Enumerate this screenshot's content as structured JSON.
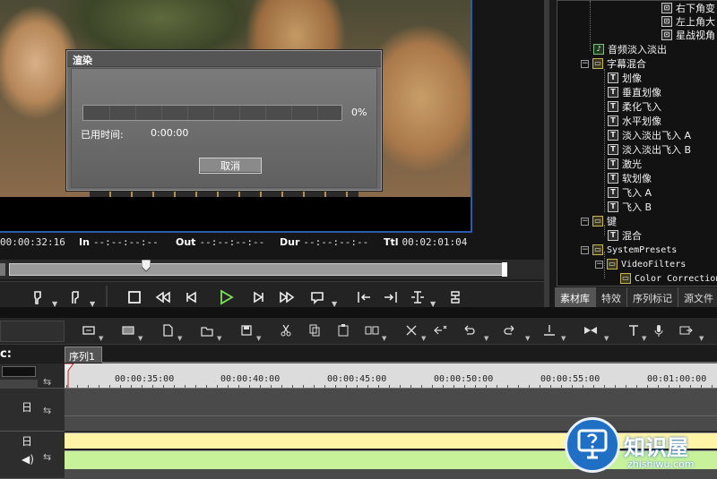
{
  "player": {
    "timecodes": [
      {
        "label": "",
        "value": "00:00:32:16"
      },
      {
        "label": "In",
        "value": "--:--:--:--"
      },
      {
        "label": "Out",
        "value": "--:--:--:--"
      },
      {
        "label": "Dur",
        "value": "--:--:--:--"
      },
      {
        "label": "Ttl",
        "value": "00:02:01:04"
      }
    ]
  },
  "render_dialog": {
    "title": "渲染",
    "progress_percent": 0,
    "progress_text": "0%",
    "elapsed_label": "已用时间:",
    "elapsed_value": "0:00:00",
    "cancel_label": "取消"
  },
  "asset_tree": {
    "items": [
      {
        "text": "右下角变",
        "icon": "effect-icon"
      },
      {
        "text": "左上角大",
        "icon": "effect-icon"
      },
      {
        "text": "星战视角",
        "icon": "effect-icon"
      },
      {
        "text": "音频淡入淡出",
        "icon": "audio-effect-icon"
      },
      {
        "text": "字幕混合",
        "icon": "folder-icon"
      },
      {
        "text": "划像",
        "icon": "title-effect-icon"
      },
      {
        "text": "垂直划像",
        "icon": "title-effect-icon"
      },
      {
        "text": "柔化飞入",
        "icon": "title-effect-icon"
      },
      {
        "text": "水平划像",
        "icon": "title-effect-icon"
      },
      {
        "text": "淡入淡出飞入 A",
        "icon": "title-effect-icon"
      },
      {
        "text": "淡入淡出飞入 B",
        "icon": "title-effect-icon"
      },
      {
        "text": "激光",
        "icon": "title-effect-icon"
      },
      {
        "text": "软划像",
        "icon": "title-effect-icon"
      },
      {
        "text": "飞入 A",
        "icon": "title-effect-icon"
      },
      {
        "text": "飞入 B",
        "icon": "title-effect-icon"
      },
      {
        "text": "键",
        "icon": "folder-icon"
      },
      {
        "text": "混合",
        "icon": "title-effect-icon"
      },
      {
        "text": "SystemPresets",
        "icon": "folder-icon"
      },
      {
        "text": "VideoFilters",
        "icon": "folder-icon"
      },
      {
        "text": "Color Correction",
        "icon": "folder-icon"
      }
    ],
    "tabs": [
      "素材库",
      "特效",
      "序列标记",
      "源文件"
    ],
    "active_tab": 0
  },
  "timeline": {
    "sequence_tab": "序列1",
    "header_mark": "c:",
    "ruler_labels": [
      "00:00:35:00",
      "00:00:40:00",
      "00:00:45:00",
      "00:00:50:00",
      "00:00:55:00",
      "00:01:00:00"
    ]
  },
  "watermark": {
    "title": "知识屋",
    "subtitle": "zhishiwu.com"
  },
  "colors": {
    "progress_fill": "#2b7bd1",
    "video_border": "#2a5db0",
    "clip_yellow": "#fff3a6",
    "clip_green": "#c8f29a",
    "watermark_blue": "#1f6fc4"
  }
}
